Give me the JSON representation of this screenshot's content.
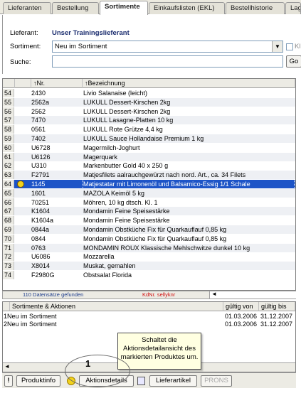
{
  "tabs": [
    {
      "label": "Lieferanten",
      "active": false
    },
    {
      "label": "Bestellung",
      "active": false
    },
    {
      "label": "Sortimente",
      "active": true
    },
    {
      "label": "Einkaufslisten (EKL)",
      "active": false
    },
    {
      "label": "Bestellhistorie",
      "active": false
    },
    {
      "label": "Lag",
      "active": false
    }
  ],
  "form": {
    "lieferant_label": "Lieferant:",
    "lieferant_value": "Unser Trainingslieferant",
    "sortiment_label": "Sortiment:",
    "sortiment_value": "Neu im Sortiment",
    "suche_label": "Suche:",
    "suche_value": "",
    "checkbox_label": "Kl",
    "search_button": "Go"
  },
  "table": {
    "headers": {
      "nr": "Nr.",
      "bez": "Bezeichnung"
    },
    "rows": [
      {
        "idx": "54",
        "nr": "2430",
        "bez": "Livio Salanaise (leicht)"
      },
      {
        "idx": "55",
        "nr": "2562a",
        "bez": "LUKULL Dessert-Kirschen 2kg"
      },
      {
        "idx": "56",
        "nr": "2562",
        "bez": "LUKULL Dessert-Kirschen 2kg"
      },
      {
        "idx": "57",
        "nr": "7470",
        "bez": "LUKULL Lasagne-Platten 10 kg"
      },
      {
        "idx": "58",
        "nr": "0561",
        "bez": "LUKULL Rote Grütze 4,4 kg"
      },
      {
        "idx": "59",
        "nr": "7402",
        "bez": "LUKULL Sauce Hollandaise Premium 1 kg"
      },
      {
        "idx": "60",
        "nr": "U6728",
        "bez": "Magermilch-Joghurt"
      },
      {
        "idx": "61",
        "nr": "U6126",
        "bez": "Magerquark"
      },
      {
        "idx": "62",
        "nr": "U310",
        "bez": "Markenbutter Gold 40 x 250 g"
      },
      {
        "idx": "63",
        "nr": "F2791",
        "bez": "Matjesfilets aalrauchgewürzt nach nord. Art., ca. 34 Filets"
      },
      {
        "idx": "64",
        "nr": "1145",
        "bez": "Matjestatar mit Limonenöl und Balsamico-Essig 1/1 Schale"
      },
      {
        "idx": "65",
        "nr": "1601",
        "bez": "MAZOLA Keimöl 5 kg"
      },
      {
        "idx": "66",
        "nr": "70251",
        "bez": "Möhren,  10 kg dtsch. Kl. 1"
      },
      {
        "idx": "67",
        "nr": "K1604",
        "bez": "Mondamin Feine Speisestärke"
      },
      {
        "idx": "68",
        "nr": "K1604a",
        "bez": "Mondamin Feine Speisestärke"
      },
      {
        "idx": "69",
        "nr": "0844a",
        "bez": "Mondamin Obstküche Fix für Quarkauflauf 0,85 kg"
      },
      {
        "idx": "70",
        "nr": "0844",
        "bez": "Mondamin Obstküche Fix für Quarkauflauf 0,85 kg"
      },
      {
        "idx": "71",
        "nr": "0763",
        "bez": "MONDAMIN ROUX Klassische Mehlschwitze dunkel 10 kg"
      },
      {
        "idx": "72",
        "nr": "U6086",
        "bez": "Mozzarella"
      },
      {
        "idx": "73",
        "nr": "X8014",
        "bez": "Muskat, gemahlen"
      },
      {
        "idx": "74",
        "nr": "F2980G",
        "bez": "Obstsalat Florida"
      }
    ],
    "selected_index": 10
  },
  "status": {
    "found": "110 Datensätze gefunden",
    "kdnr": "KdNr. sellyknr"
  },
  "aktionen": {
    "headers": {
      "name": "Sortimente & Aktionen",
      "von": "gültig von",
      "bis": "gültig bis"
    },
    "rows": [
      {
        "idx": "1",
        "name": "Neu im Sortiment",
        "von": "01.03.2006",
        "bis": "31.12.2007"
      },
      {
        "idx": "2",
        "name": "Neu im Sortiment",
        "von": "01.03.2006",
        "bis": "31.12.2007"
      }
    ]
  },
  "toolbar": {
    "info_icon": "!",
    "produktinfo": "Produktinfo",
    "aktionsdetails": "Aktionsdetails",
    "lieferartikel": "Lieferartikel",
    "prons": "PRONS"
  },
  "tooltip": {
    "line1": "Schaltet die",
    "line2": "Aktionsdetailansicht des",
    "line3": "markierten Produktes um."
  },
  "callout": {
    "number": "1"
  },
  "colors": {
    "selection": "#1d54c7",
    "smiley": "#f2d21c",
    "kdnr_red": "#d01010"
  }
}
